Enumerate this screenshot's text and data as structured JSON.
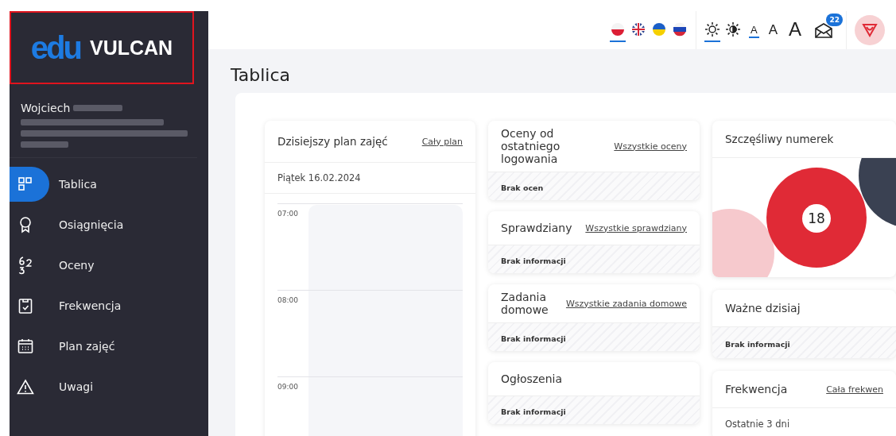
{
  "sidebar": {
    "logo": {
      "mark": "edu",
      "name": "VULCAN"
    },
    "user": {
      "name": "Wojciech"
    },
    "items": [
      {
        "label": "Tablica",
        "selected": true
      },
      {
        "label": "Osiągnięcia",
        "selected": false
      },
      {
        "label": "Oceny",
        "selected": false
      },
      {
        "label": "Frekwencja",
        "selected": false
      },
      {
        "label": "Plan zajęć",
        "selected": false
      },
      {
        "label": "Uwagi",
        "selected": false
      }
    ]
  },
  "toolbar": {
    "languages": [
      {
        "kind": "pl",
        "selected": true
      },
      {
        "kind": "gb",
        "selected": false
      },
      {
        "kind": "ua",
        "selected": false
      },
      {
        "kind": "ru",
        "selected": false
      }
    ],
    "themes": [
      {
        "kind": "light",
        "selected": true
      },
      {
        "kind": "contrast",
        "selected": false
      }
    ],
    "font_sizes": [
      {
        "label": "A",
        "selected": true
      },
      {
        "label": "A",
        "selected": false
      },
      {
        "label": "A",
        "selected": false
      }
    ],
    "messages": {
      "badge": "22"
    }
  },
  "page": {
    "title": "Tablica"
  },
  "schedule": {
    "title": "Dzisiejszy plan zajęć",
    "link": "Cały plan",
    "date": "Piątek 16.02.2024",
    "hours": [
      "07:00",
      "08:00",
      "09:00"
    ]
  },
  "middle_cards": [
    {
      "title": "Oceny od ostatniego logowania",
      "link": "Wszystkie oceny",
      "body": "Brak ocen"
    },
    {
      "title": "Sprawdziany",
      "link": "Wszystkie sprawdziany",
      "body": "Brak informacji"
    },
    {
      "title": "Zadania domowe",
      "link": "Wszystkie zadania domowe",
      "body": "Brak informacji"
    },
    {
      "title": "Ogłoszenia",
      "body": "Brak informacji"
    }
  ],
  "lucky_number": {
    "title": "Szczęśliwy numerek",
    "number": "18"
  },
  "important": {
    "title": "Ważne dzisiaj",
    "body": "Brak informacji"
  },
  "attendance": {
    "title": "Frekwencja",
    "link": "Cała frekwen",
    "period": "Ostatnie 3 dni"
  }
}
